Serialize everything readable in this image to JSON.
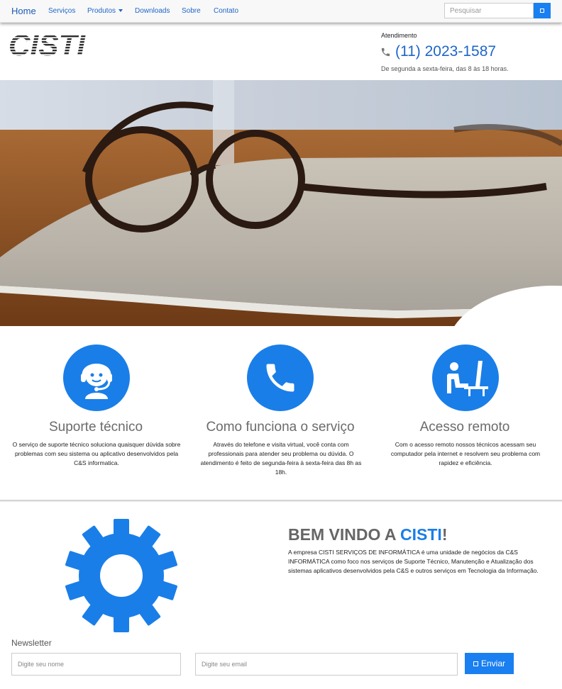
{
  "nav": {
    "home": "Home",
    "items": [
      {
        "label": "Serviços"
      },
      {
        "label": "Produtos"
      },
      {
        "label": "Downloads"
      },
      {
        "label": "Sobre"
      },
      {
        "label": "Contato"
      }
    ],
    "search_placeholder": "Pesquisar",
    "search_icon": "search-icon"
  },
  "header": {
    "logo_text": "CISTI",
    "attendance_label": "Atendimento",
    "phone": "(11) 2023-1587",
    "hours": "De segunda a sexta-feira, das 8 às 18 horas."
  },
  "features": [
    {
      "icon": "support-agent-icon",
      "title": "Suporte técnico",
      "text": "O serviço de suporte técnico soluciona quaisquer dúvida sobre problemas com seu sistema ou aplicativo desenvolvidos pela C&S informatica."
    },
    {
      "icon": "phone-icon",
      "title": "Como funciona o serviço",
      "text": "Através do telefone e visita virtual, você conta com professionais para atender seu problema ou dúvida. O atendimento é feito de segunda-feira à sexta-feira das 8h as 18h."
    },
    {
      "icon": "remote-access-icon",
      "title": "Acesso remoto",
      "text": "Com o acesso remoto nossos técnicos acessam seu computador pela internet e resolvem seu problema com rapidez e eficiência."
    }
  ],
  "welcome": {
    "title_prefix": "BEM VINDO A ",
    "title_highlight": "CISTI",
    "title_suffix": "!",
    "text": "A empresa CISTI SERVIÇOS DE INFORMÁTICA é uma unidade de negócios da C&S INFORMÁTICA como foco nos serviços de Suporte Técnico, Manutenção e Atualização dos sistemas aplicativos desenvolvidos pela C&S e outros serviços em Tecnologia da Informação.",
    "icon": "gear-icon"
  },
  "newsletter": {
    "label": "Newsletter",
    "name_placeholder": "Digite seu nome",
    "email_placeholder": "Digite seu email",
    "send_label": "Enviar"
  },
  "colors": {
    "accent": "#1a7ee8",
    "nav_link": "#1e66c8"
  }
}
